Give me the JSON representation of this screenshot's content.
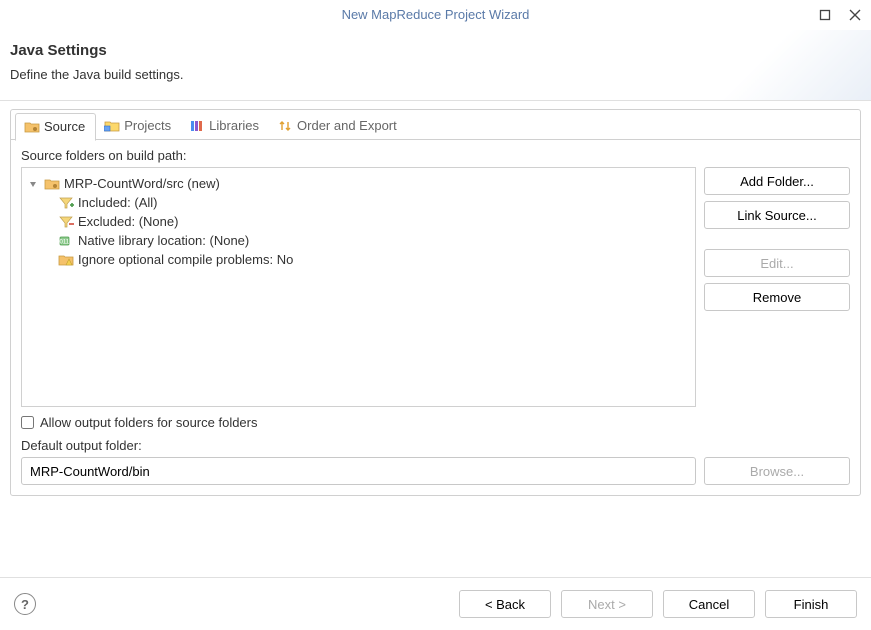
{
  "window": {
    "title": "New MapReduce Project Wizard"
  },
  "header": {
    "title": "Java Settings",
    "subtitle": "Define the Java build settings."
  },
  "tabs": {
    "source": "Source",
    "projects": "Projects",
    "libraries": "Libraries",
    "order_export": "Order and Export"
  },
  "source_section": {
    "label": "Source folders on build path:",
    "root": "MRP-CountWord/src (new)",
    "included": "Included: (All)",
    "excluded": "Excluded: (None)",
    "native_lib": "Native library location: (None)",
    "ignore_optional": "Ignore optional compile problems: No"
  },
  "side_buttons": {
    "add_folder": "Add Folder...",
    "link_source": "Link Source...",
    "edit": "Edit...",
    "remove": "Remove"
  },
  "allow_output_label": "Allow output folders for source folders",
  "output": {
    "label": "Default output folder:",
    "value": "MRP-CountWord/bin",
    "browse": "Browse..."
  },
  "footer": {
    "help": "?",
    "back": "< Back",
    "next": "Next >",
    "cancel": "Cancel",
    "finish": "Finish"
  }
}
